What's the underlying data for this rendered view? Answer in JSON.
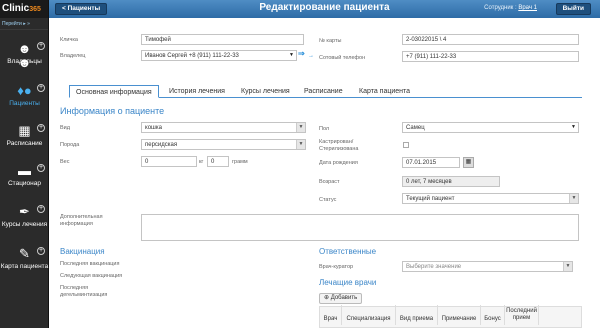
{
  "app": {
    "logo_main": "Clinic",
    "logo_suffix": "365",
    "nav_link": "Перейти ▸ »"
  },
  "sidebar": {
    "items": [
      {
        "label": "Владельцы",
        "icon": "people-icon"
      },
      {
        "label": "Пациенты",
        "icon": "pets-icon"
      },
      {
        "label": "Расписание",
        "icon": "calendar-icon"
      },
      {
        "label": "Стационар",
        "icon": "bed-icon"
      },
      {
        "label": "Курсы лечения",
        "icon": "syringe-icon"
      },
      {
        "label": "Карта пациента",
        "icon": "card-icon"
      }
    ]
  },
  "topbar": {
    "back": "< Пациенты",
    "title": "Редактирование пациента",
    "employee_label": "Сотрудник :",
    "employee_name": "Врач 1",
    "exit": "Выйти"
  },
  "form": {
    "nickname_label": "Кличка",
    "nickname": "Тимофей",
    "owner_label": "Владелец",
    "owner": "Иванов Сергей +8 (911) 111-22-33",
    "card_label": "№ карты",
    "card": "2-03022015 \\ 4",
    "phone_label": "Сотовый телефон",
    "phone": "+7 (911) 111-22-33"
  },
  "tabs": [
    "Основная информация",
    "История лечения",
    "Курсы лечения",
    "Расписание",
    "Карта пациента"
  ],
  "info": {
    "title": "Информация о пациенте",
    "species_label": "Вид",
    "species": "кошка",
    "breed_label": "Порода",
    "breed": "персидская",
    "weight_label": "Вес",
    "weight_kg": "0",
    "kg": "кг",
    "weight_g": "0",
    "gram": "грамм",
    "sex_label": "Пол",
    "sex": "Самец",
    "castrated_label_1": "Кастрирован/",
    "castrated_label_2": "Стерилизована",
    "birth_label": "Дата рождения",
    "birth": "07.01.2015",
    "age_label": "Возраст",
    "age": "0 лет, 7 месяцев",
    "status_label": "Статус",
    "status": "Текущий пациент",
    "extra_label_1": "Дополнительная",
    "extra_label_2": "информация"
  },
  "vaccination": {
    "title": "Вакцинация",
    "last_vac": "Последняя вакцинация",
    "next_vac": "Следующая вакцинация",
    "last_deg_1": "Последняя",
    "last_deg_2": "дегельминтизация"
  },
  "responsible": {
    "title": "Ответственные",
    "curator_label": "Врач-куратор",
    "curator_placeholder": "Выберите значение"
  },
  "doctors": {
    "title": "Лечащие врачи",
    "add": "Добавить",
    "columns": [
      "Врач",
      "Специализация",
      "Вид приема",
      "Примечание",
      "Бонус",
      "Последний прием"
    ]
  }
}
